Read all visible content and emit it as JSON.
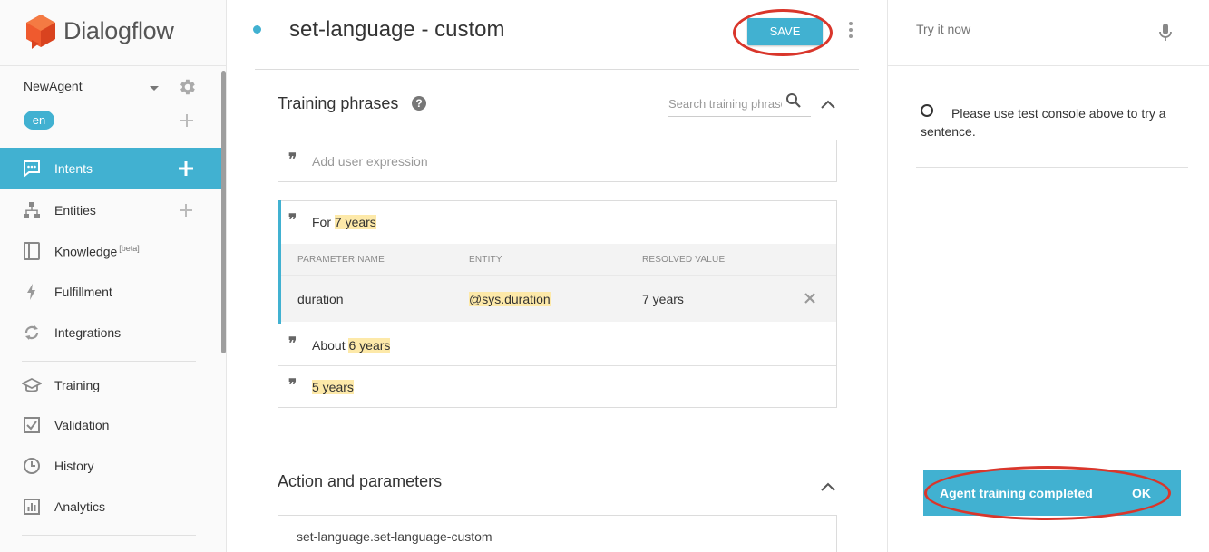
{
  "app": {
    "name": "Dialogflow"
  },
  "agent": {
    "name": "NewAgent",
    "language": "en"
  },
  "sidebar": {
    "items": [
      {
        "label": "Intents",
        "icon": "chat-bubble-icon"
      },
      {
        "label": "Entities",
        "icon": "hierarchy-icon"
      },
      {
        "label": "Knowledge",
        "badge": "[beta]",
        "icon": "book-icon"
      },
      {
        "label": "Fulfillment",
        "icon": "bolt-icon"
      },
      {
        "label": "Integrations",
        "icon": "sync-icon"
      },
      {
        "label": "Training",
        "icon": "graduation-cap-icon"
      },
      {
        "label": "Validation",
        "icon": "checkbox-icon"
      },
      {
        "label": "History",
        "icon": "clock-icon"
      },
      {
        "label": "Analytics",
        "icon": "bar-chart-icon"
      }
    ]
  },
  "header": {
    "intent_title": "set-language - custom",
    "save_label": "SAVE"
  },
  "training": {
    "title": "Training phrases",
    "search_placeholder": "Search training phrases",
    "add_placeholder": "Add user expression",
    "phrases": [
      {
        "prefix": "For ",
        "highlight": "7 years"
      },
      {
        "prefix": "About ",
        "highlight": "6 years"
      },
      {
        "prefix": "",
        "highlight": "5 years"
      }
    ],
    "param_headers": {
      "name": "PARAMETER NAME",
      "entity": "ENTITY",
      "resolved": "RESOLVED VALUE"
    },
    "param_row": {
      "name": "duration",
      "entity": "@sys.duration",
      "resolved": "7 years"
    }
  },
  "action": {
    "title": "Action and parameters",
    "value": "set-language.set-language-custom"
  },
  "right_panel": {
    "try_placeholder": "Try it now",
    "info_text": "Please use test console above to try a sentence.",
    "toast_message": "Agent training completed",
    "toast_action": "OK"
  },
  "colors": {
    "accent": "#41b1d1",
    "highlight": "#fde9a9",
    "annotation_ring": "#d9362b",
    "logo": "#ef5a2e"
  }
}
